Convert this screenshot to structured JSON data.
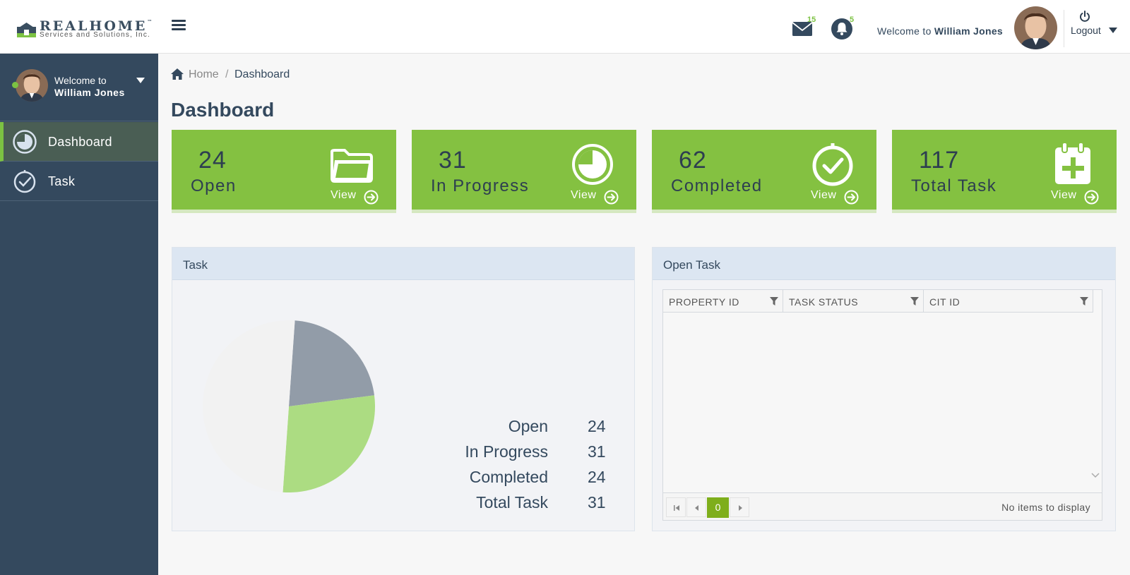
{
  "brand": {
    "name": "REALHOME",
    "trademark": "™",
    "subtitle": "Services and Solutions, Inc."
  },
  "header": {
    "mail_count": "15",
    "notification_count": "5",
    "welcome_prefix": "Welcome to",
    "user_name": "William Jones",
    "logout_label": "Logout"
  },
  "sidebar": {
    "welcome_prefix": "Welcome to",
    "user_name": "William Jones",
    "items": [
      {
        "label": "Dashboard",
        "icon": "dashboard-pie-icon",
        "active": true
      },
      {
        "label": "Task",
        "icon": "task-check-icon",
        "active": false
      }
    ]
  },
  "breadcrumb": {
    "home": "Home",
    "separator": "/",
    "current": "Dashboard"
  },
  "page_title": "Dashboard",
  "stats": [
    {
      "value": "24",
      "label": "Open",
      "icon": "folder-icon",
      "link": "View"
    },
    {
      "value": "31",
      "label": "In Progress",
      "icon": "progress-pie-icon",
      "link": "View"
    },
    {
      "value": "62",
      "label": "Completed",
      "icon": "check-circle-icon",
      "link": "View"
    },
    {
      "value": "117",
      "label": "Total Task",
      "icon": "calendar-plus-icon",
      "link": "View"
    }
  ],
  "task_panel": {
    "title": "Task",
    "legend": [
      {
        "name": "Open",
        "value": "24"
      },
      {
        "name": "In Progress",
        "value": "31"
      },
      {
        "name": "Completed",
        "value": "24"
      },
      {
        "name": "Total Task",
        "value": "31"
      }
    ]
  },
  "chart_data": {
    "type": "pie",
    "title": "",
    "slices": [
      {
        "name": "Open",
        "value": 24,
        "color": "#929ca8"
      },
      {
        "name": "In Progress",
        "value": 31,
        "color": "#acdc82"
      },
      {
        "name": "Completed",
        "value": 24,
        "color": "#f2f2f2"
      },
      {
        "name": "Total Task",
        "value": 31,
        "color": "#f2f2f2"
      }
    ],
    "legend_position": "bottom-right"
  },
  "open_task_panel": {
    "title": "Open Task",
    "columns": [
      "PROPERTY ID",
      "TASK STATUS",
      "CIT ID"
    ],
    "rows": [],
    "current_page": "0",
    "empty_message": "No items to display"
  },
  "colors": {
    "sidebar": "#34495e",
    "accent_green": "#84c141",
    "pager_green": "#7eae1b",
    "text_dark": "#2d3e50"
  }
}
